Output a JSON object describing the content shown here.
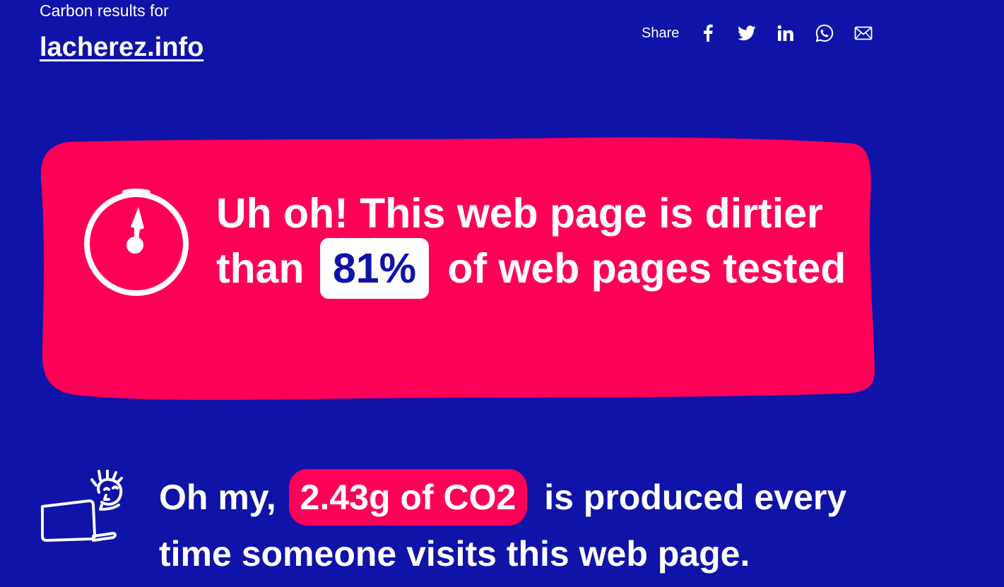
{
  "header": {
    "intro": "Carbon results for",
    "site": "lacherez.info"
  },
  "share": {
    "label": "Share",
    "buttons": [
      {
        "name": "facebook",
        "icon": "facebook-icon"
      },
      {
        "name": "twitter",
        "icon": "twitter-icon"
      },
      {
        "name": "linkedin",
        "icon": "linkedin-icon"
      },
      {
        "name": "whatsapp",
        "icon": "whatsapp-icon"
      },
      {
        "name": "email",
        "icon": "mail-icon"
      }
    ]
  },
  "result": {
    "line_before": "Uh oh! This web page is dirtier than",
    "percentage": "81%",
    "line_after": "of web pages tested",
    "icon": "gauge-icon"
  },
  "co2": {
    "prefix": "Oh my,",
    "amount": "2.43g of CO2",
    "suffix": "is produced every time someone visits this web page.",
    "icon": "person-laptop-illustration"
  },
  "colors": {
    "background": "#0f13a8",
    "accent_pink": "#ff0058",
    "text": "#ffffff"
  }
}
